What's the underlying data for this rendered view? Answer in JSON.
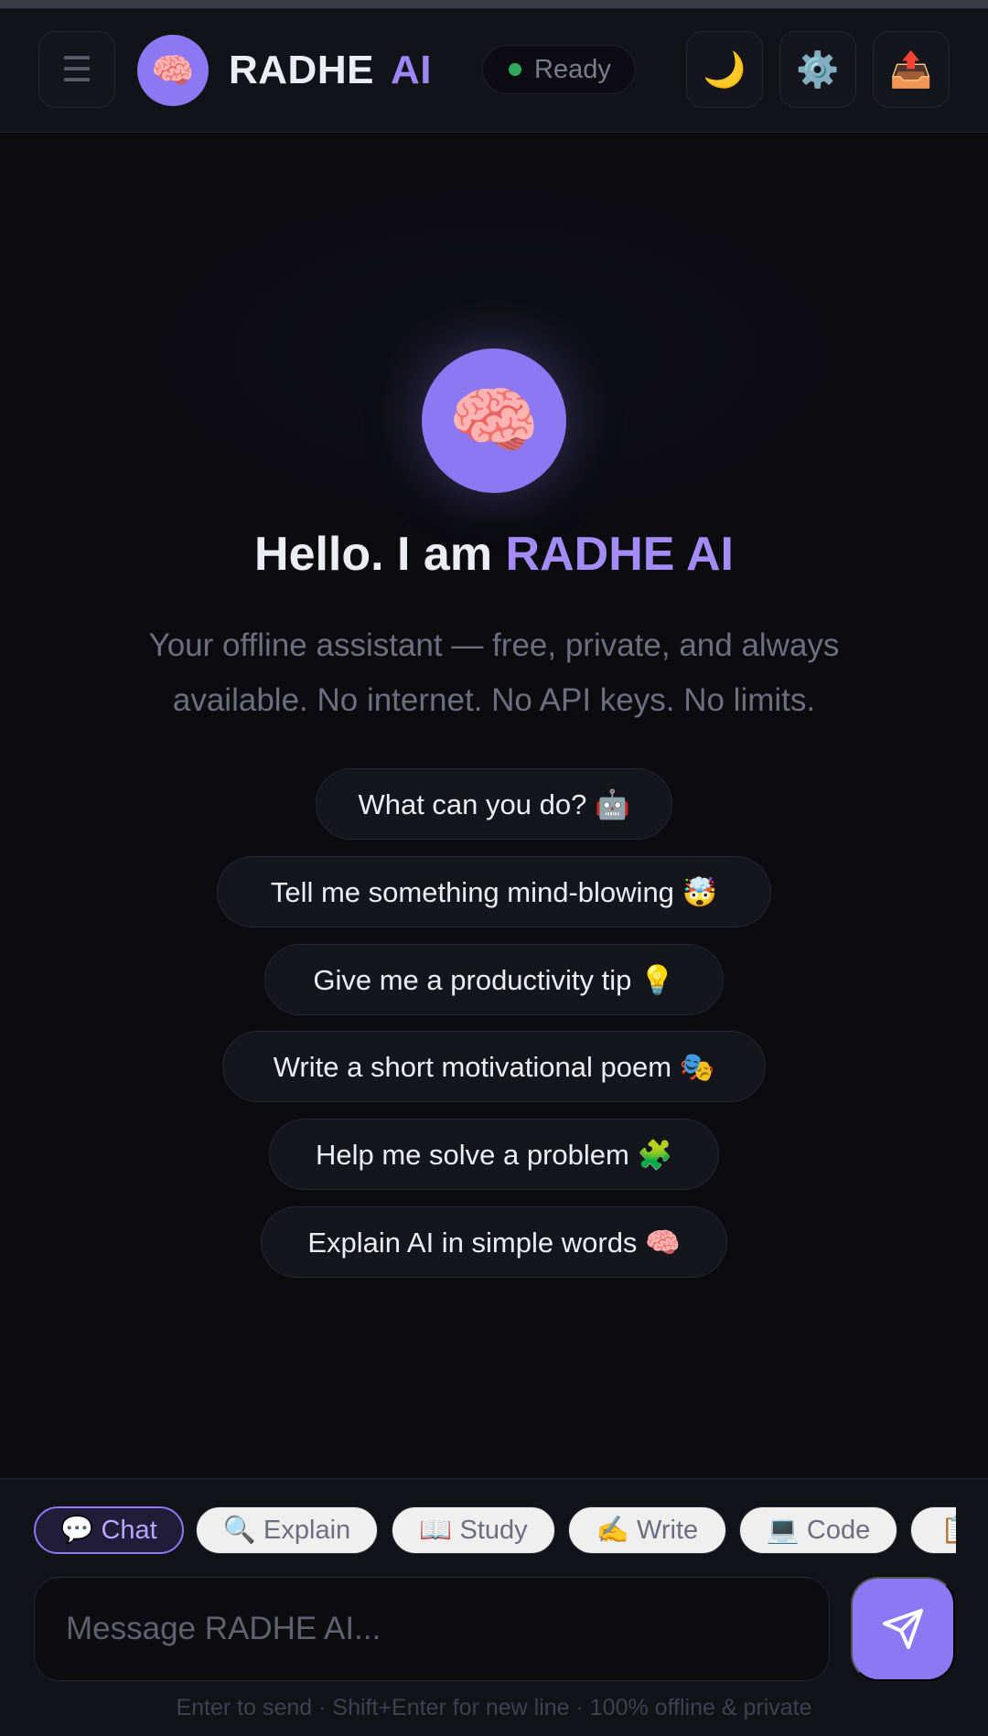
{
  "header": {
    "menu_icon": "☰",
    "logo_icon": "🧠",
    "brand_name": "RADHE",
    "brand_suffix": "AI",
    "status_text": "Ready",
    "status_color": "#2faa5c",
    "theme_icon": "🌙",
    "settings_icon": "⚙️",
    "export_icon": "📤"
  },
  "hero": {
    "avatar_icon": "🧠",
    "title_prefix": "Hello. I am",
    "title_accent": "RADHE AI",
    "subtitle": "Your offline assistant — free, private, and always available. No internet. No API keys. No limits."
  },
  "suggestions": [
    "What can you do? 🤖",
    "Tell me something mind-blowing 🤯",
    "Give me a productivity tip 💡",
    "Write a short motivational poem 🎭",
    "Help me solve a problem 🧩",
    "Explain AI in simple words 🧠"
  ],
  "modes": [
    {
      "label": "💬 Chat",
      "active": true
    },
    {
      "label": "🔍 Explain",
      "active": false
    },
    {
      "label": "📖 Study",
      "active": false
    },
    {
      "label": "✍️ Write",
      "active": false
    },
    {
      "label": "💻 Code",
      "active": false
    },
    {
      "label": "📋",
      "active": false
    }
  ],
  "composer": {
    "placeholder": "Message RADHE AI...",
    "hint": "Enter to send · Shift+Enter for new line · 100% offline & private"
  },
  "colors": {
    "accent": "#8b78f2",
    "background": "#0b0b10",
    "header": "#121219"
  }
}
